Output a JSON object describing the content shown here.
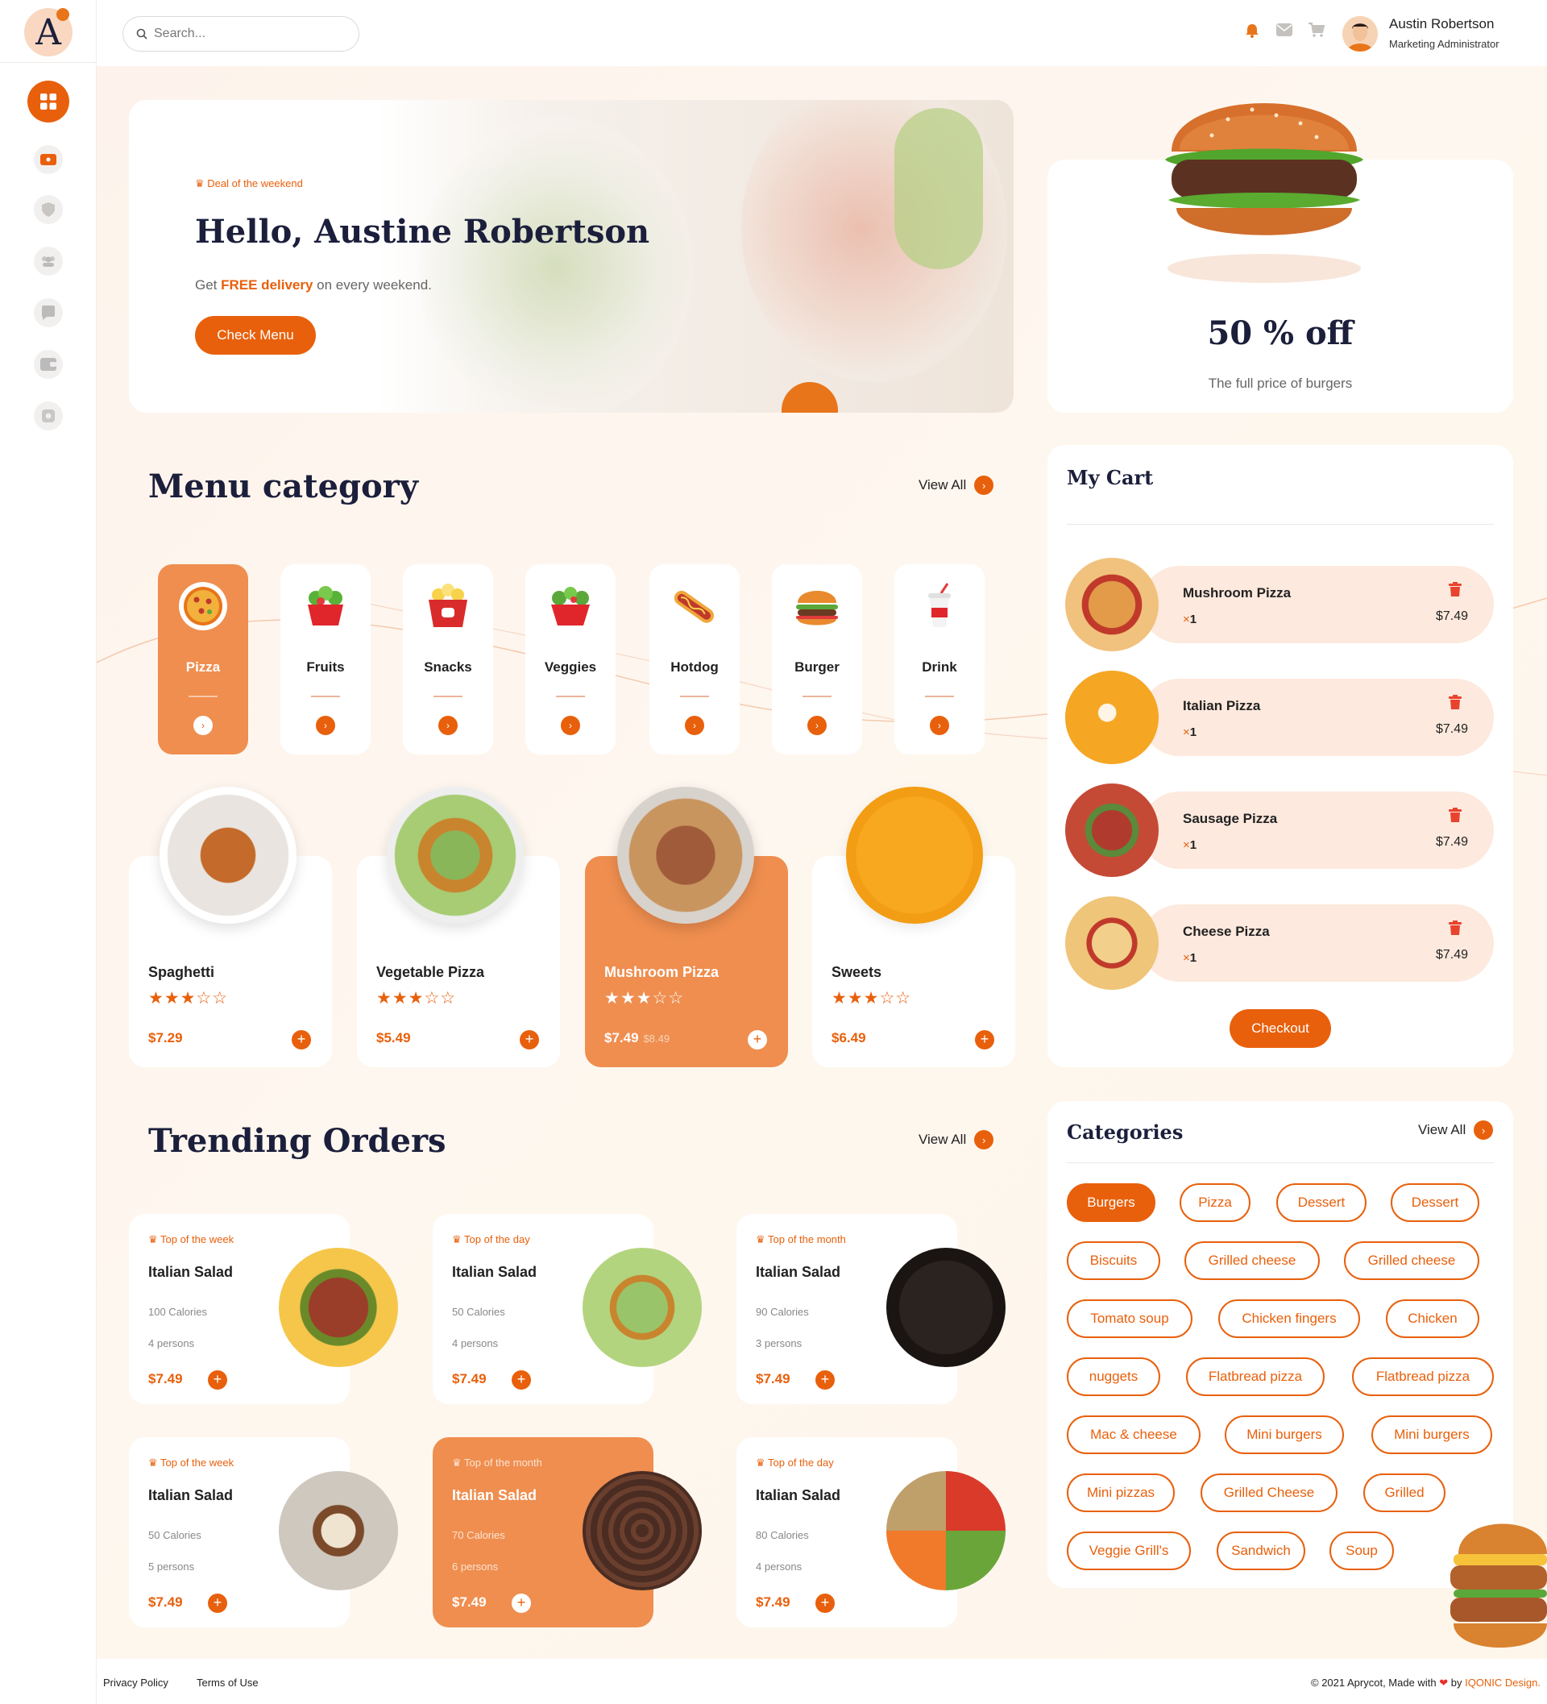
{
  "brand": {
    "logo_letter": "A"
  },
  "search": {
    "placeholder": "Search..."
  },
  "user": {
    "name": "Austin Robertson",
    "role": "Marketing Administrator"
  },
  "hero": {
    "deal_label": "Deal of the weekend",
    "greeting": "Hello,  Austine Robertson",
    "subtitle_pre": "Get ",
    "subtitle_highlight": "FREE delivery",
    "subtitle_post": " on every weekend.",
    "button": "Check Menu"
  },
  "promo": {
    "title": "50 % off",
    "subtitle": "The full price of burgers"
  },
  "menu_category": {
    "title": "Menu category",
    "view_all": "View All",
    "items": [
      {
        "label": "Pizza",
        "icon": "pizza-icon"
      },
      {
        "label": "Fruits",
        "icon": "fruit-bowl-icon"
      },
      {
        "label": "Snacks",
        "icon": "popcorn-icon"
      },
      {
        "label": "Veggies",
        "icon": "salad-bowl-icon"
      },
      {
        "label": "Hotdog",
        "icon": "hotdog-icon"
      },
      {
        "label": "Burger",
        "icon": "burger-icon"
      },
      {
        "label": "Drink",
        "icon": "drink-cup-icon"
      }
    ]
  },
  "foods": [
    {
      "name": "Spaghetti",
      "stars": "★★★☆☆",
      "price": "$7.29",
      "old_price": ""
    },
    {
      "name": "Vegetable Pizza",
      "stars": "★★★☆☆",
      "price": "$5.49",
      "old_price": ""
    },
    {
      "name": "Mushroom Pizza",
      "stars": "★★★☆☆",
      "price": "$7.49",
      "old_price": "$8.49"
    },
    {
      "name": "Sweets",
      "stars": "★★★☆☆",
      "price": "$6.49",
      "old_price": ""
    }
  ],
  "cart": {
    "title": "My Cart",
    "qty_prefix": "×",
    "items": [
      {
        "name": "Mushroom Pizza",
        "qty": "1",
        "price": "$7.49"
      },
      {
        "name": "Italian Pizza",
        "qty": "1",
        "price": "$7.49"
      },
      {
        "name": "Sausage Pizza",
        "qty": "1",
        "price": "$7.49"
      },
      {
        "name": "Cheese Pizza",
        "qty": "1",
        "price": "$7.49"
      }
    ],
    "checkout": "Checkout"
  },
  "trending": {
    "title": "Trending Orders",
    "view_all": "View All",
    "items": [
      {
        "tag": "Top of the week",
        "name": "Italian Salad",
        "calories": "100 Calories",
        "persons": "4 persons",
        "price": "$7.49"
      },
      {
        "tag": "Top of the day",
        "name": "Italian Salad",
        "calories": "50 Calories",
        "persons": "4 persons",
        "price": "$7.49"
      },
      {
        "tag": "Top of the month",
        "name": "Italian Salad",
        "calories": "90 Calories",
        "persons": "3 persons",
        "price": "$7.49"
      },
      {
        "tag": "Top of the week",
        "name": "Italian Salad",
        "calories": "50 Calories",
        "persons": "5 persons",
        "price": "$7.49"
      },
      {
        "tag": "Top of the month",
        "name": "Italian Salad",
        "calories": "70 Calories",
        "persons": "6 persons",
        "price": "$7.49"
      },
      {
        "tag": "Top of the day",
        "name": "Italian Salad",
        "calories": "80 Calories",
        "persons": "4 persons",
        "price": "$7.49"
      }
    ]
  },
  "categories": {
    "title": "Categories",
    "view_all": "View All",
    "tags": [
      "Burgers",
      "Pizza",
      "Dessert",
      "Dessert",
      "Biscuits",
      "Grilled cheese",
      "Grilled cheese",
      "Tomato soup",
      "Chicken fingers",
      "Chicken",
      "nuggets",
      "Flatbread pizza",
      "Flatbread pizza",
      "Mac & cheese",
      "Mini burgers",
      "Mini burgers",
      "Mini pizzas",
      "Grilled Cheese",
      "Grilled",
      "Veggie Grill's",
      "Sandwich",
      "Soup"
    ]
  },
  "footer": {
    "privacy": "Privacy Policy",
    "terms": "Terms of Use",
    "copyright_pre": "© 2021 Aprycot, Made with",
    "copyright_by": "by",
    "credit": "IQONIC Design."
  },
  "colors": {
    "accent": "#e8600c",
    "accent_soft": "#ef8e4f",
    "navy": "#1b1f3b"
  }
}
